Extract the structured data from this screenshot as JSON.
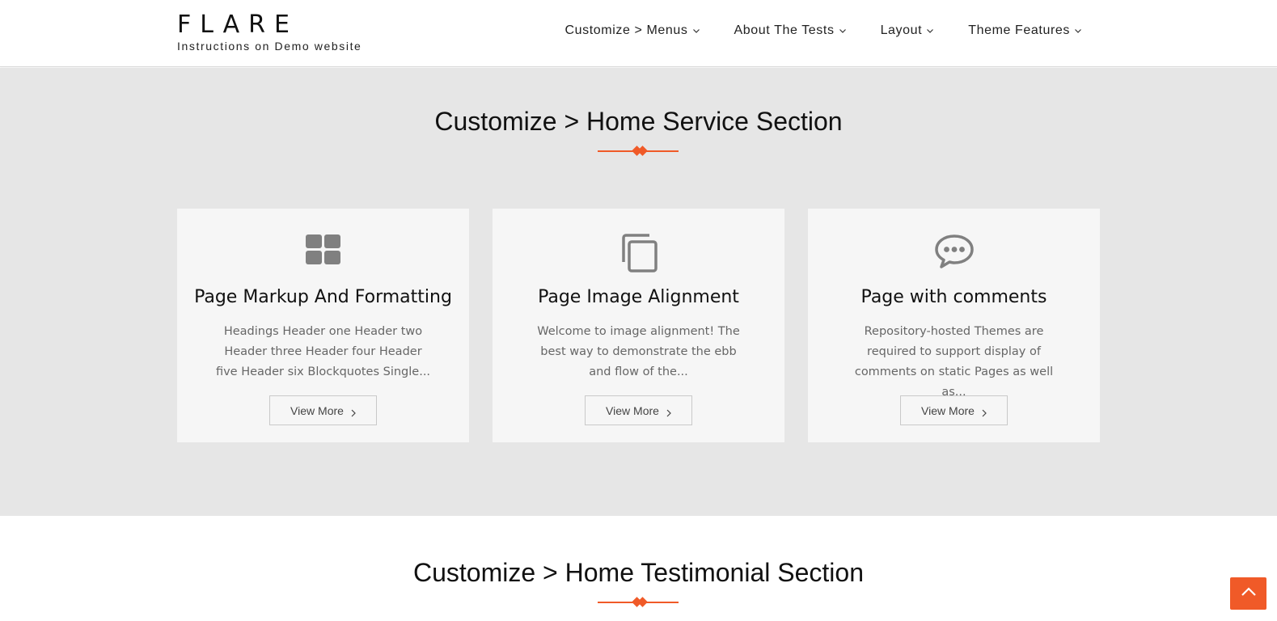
{
  "brand": {
    "title": "FLARE",
    "tagline": "Instructions on Demo website"
  },
  "nav": [
    {
      "label": "Customize > Menus"
    },
    {
      "label": "About The Tests"
    },
    {
      "label": "Layout"
    },
    {
      "label": "Theme Features"
    }
  ],
  "service": {
    "title": "Customize > Home Service Section",
    "cards": [
      {
        "icon": "grid-icon",
        "title": "Page Markup And Formatting",
        "text": "Headings Header one Header two Header three Header four Header five Header six Blockquotes Single...",
        "button": "View More"
      },
      {
        "icon": "copy-icon",
        "title": "Page Image Alignment",
        "text": "Welcome to image alignment! The best way to demonstrate the ebb and flow of the...",
        "button": "View More"
      },
      {
        "icon": "comment-icon",
        "title": "Page with comments",
        "text": "Repository-hosted Themes are required to support display of comments on static Pages as well as...",
        "button": "View More"
      }
    ]
  },
  "testimonial": {
    "title": "Customize > Home Testimonial Section"
  },
  "colors": {
    "accent": "#f05a28",
    "section_bg": "#e6e6e6",
    "card_bg": "#f6f6f6",
    "icon": "#808080"
  },
  "scroll_top": {
    "icon": "chevron-up-icon"
  }
}
